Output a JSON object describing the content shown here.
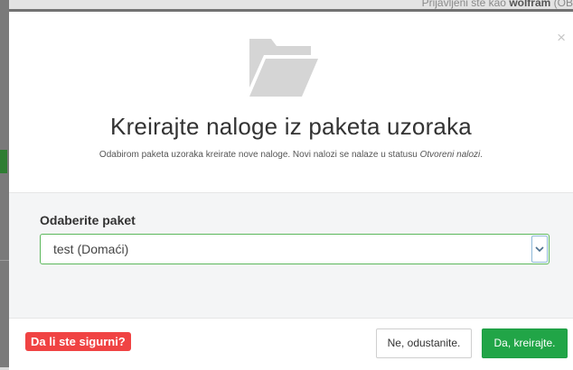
{
  "background": {
    "login_prefix": "Prijavljeni ste kao ",
    "login_user": "wolfram",
    "login_suffix": " (OB"
  },
  "modal": {
    "close_label": "×",
    "title": "Kreirajte naloge iz paketa uzoraka",
    "subtitle_main": "Odabirom paketa uzoraka kreirate nove naloge. Novi nalozi se nalaze u statusu ",
    "subtitle_status": "Otvoreni nalozi",
    "subtitle_end": ".",
    "field_label": "Odaberite paket",
    "selected_package": "test (Domaći)",
    "warning_badge": "Da li ste sigurni?",
    "cancel_button": "Ne, odustanite.",
    "confirm_button": "Da, kreirajte."
  },
  "colors": {
    "confirm_green": "#21a547",
    "warning_red": "#f04343",
    "select_border_green": "#5cb85c",
    "folder_icon_gray": "#d5d5d5"
  },
  "icons": {
    "header": "folder-open-icon",
    "select": "chevron-down-icon",
    "close": "close-icon"
  }
}
